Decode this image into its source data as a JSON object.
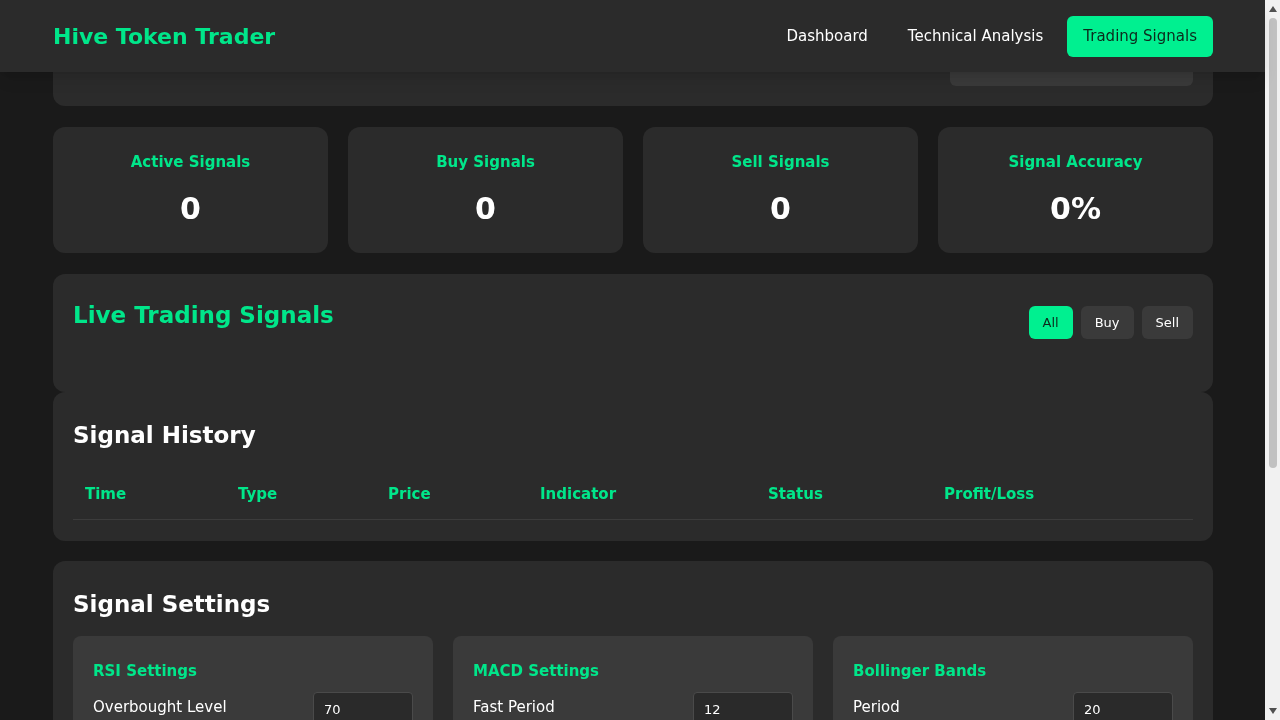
{
  "header": {
    "brand": "Hive Token Trader",
    "nav": [
      {
        "label": "Dashboard",
        "selected": false
      },
      {
        "label": "Technical Analysis",
        "selected": false
      },
      {
        "label": "Trading Signals",
        "selected": true
      }
    ]
  },
  "stats": [
    {
      "label": "Active Signals",
      "value": "0"
    },
    {
      "label": "Buy Signals",
      "value": "0"
    },
    {
      "label": "Sell Signals",
      "value": "0"
    },
    {
      "label": "Signal Accuracy",
      "value": "0%"
    }
  ],
  "live": {
    "title": "Live Trading Signals",
    "filters": [
      {
        "label": "All",
        "selected": true
      },
      {
        "label": "Buy",
        "selected": false
      },
      {
        "label": "Sell",
        "selected": false
      }
    ]
  },
  "history": {
    "title": "Signal History",
    "columns": [
      "Time",
      "Type",
      "Price",
      "Indicator",
      "Status",
      "Profit/Loss"
    ]
  },
  "settings": {
    "title": "Signal Settings",
    "groups": [
      {
        "title": "RSI Settings",
        "fields": [
          {
            "label": "Overbought Level",
            "value": "70"
          }
        ]
      },
      {
        "title": "MACD Settings",
        "fields": [
          {
            "label": "Fast Period",
            "value": "12"
          }
        ]
      },
      {
        "title": "Bollinger Bands",
        "fields": [
          {
            "label": "Period",
            "value": "20"
          }
        ]
      }
    ]
  }
}
